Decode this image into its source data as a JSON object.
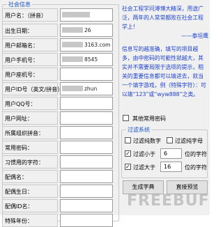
{
  "group_title": "社会信息",
  "fields": [
    {
      "label": "用户名：（拼音）",
      "value": ""
    },
    {
      "label": "出生日期：",
      "value": "26"
    },
    {
      "label": "用户邮箱名：",
      "value": "3163.com"
    },
    {
      "label": "用户手机号：",
      "value": "8545"
    },
    {
      "label": "用户座机号：",
      "value": ""
    },
    {
      "label": "用户ID号（英文/拼音）",
      "value": "zhun"
    },
    {
      "label": "用户QQ号：",
      "value": ""
    },
    {
      "label": "用户网址：",
      "value": ""
    },
    {
      "label": "所属组织拼音：",
      "value": ""
    },
    {
      "label": "常用密码：",
      "value": ""
    },
    {
      "label": "习惯用的字符：",
      "value": ""
    },
    {
      "label": "配偶名：",
      "value": ""
    },
    {
      "label": "配偶生日：",
      "value": ""
    },
    {
      "label": "配偶ID名：",
      "value": ""
    },
    {
      "label": "特殊年份：",
      "value": ""
    }
  ],
  "note_top": "社会工程学问溥博大精深，用途广泛，两年的人常常都败在社会工程学上！",
  "note_author": "——泰坦鹰",
  "note_middle": "信息写的越准确，填写的项目越多，由中密码的可能性就越大，其实并不需要局限于选项的提示，相关的重要信息都可以填进去，就当一个填字游戏，例（特殊字符）：可以填“123”或“wyw888”之类。",
  "other_pwd_label": "其他常用密码",
  "filter": {
    "title": "过滤系统",
    "pure_num_label": "过滤纯数字",
    "pure_char_label": "过滤纯字母",
    "less_than_label": "过滤小于",
    "less_than_value": "6",
    "greater_than_label": "过滤大于",
    "greater_than_value": "16",
    "digits_suffix": "位的字符"
  },
  "buttons": {
    "generate": "生成字典",
    "preview": "直接预览"
  },
  "watermark": "FREEBUF"
}
